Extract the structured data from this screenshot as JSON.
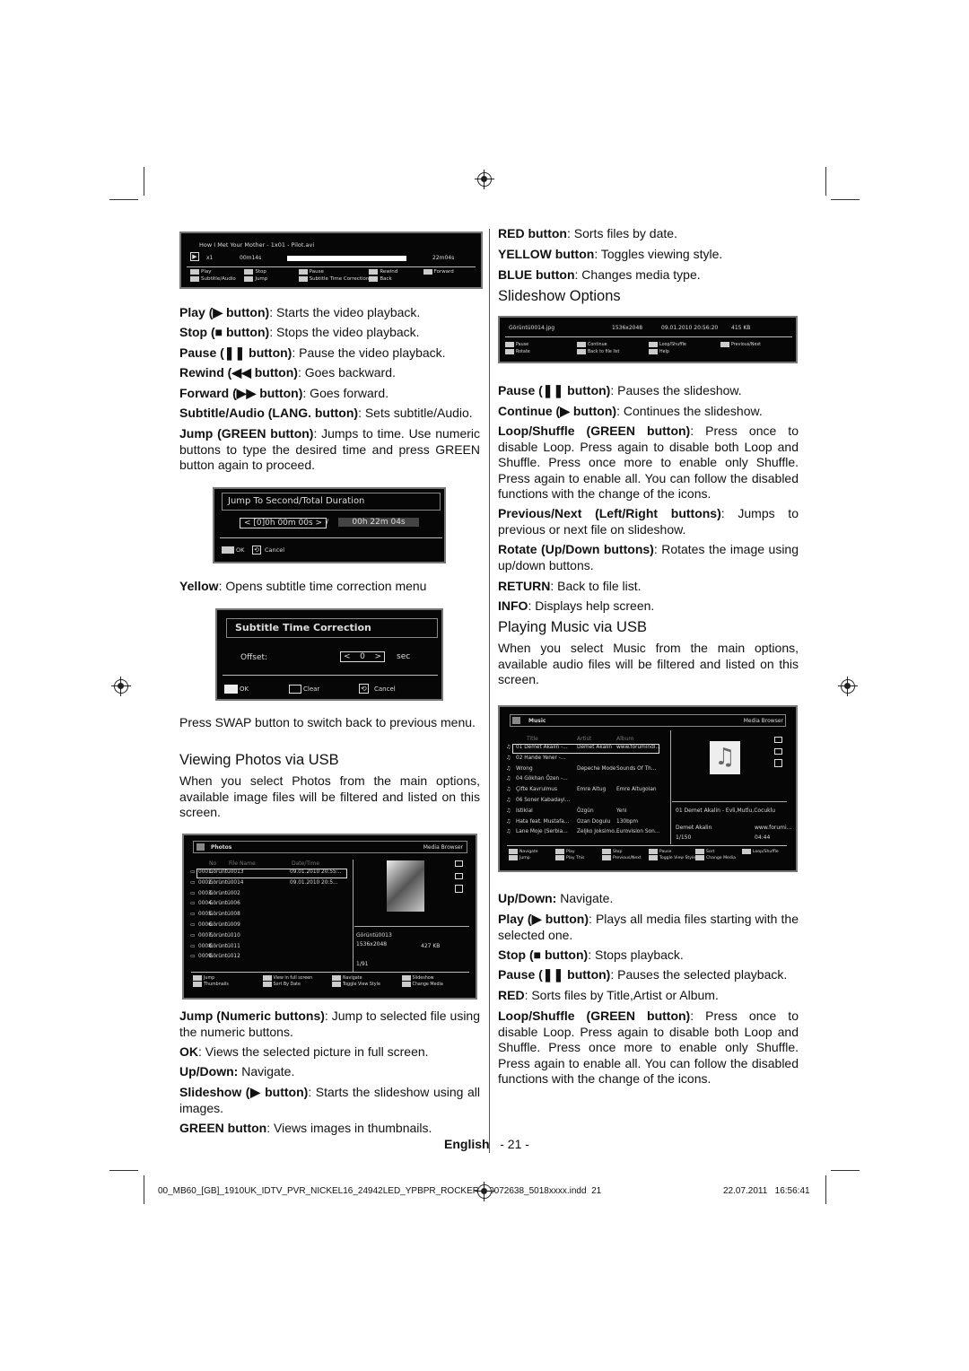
{
  "video_bar": {
    "title": "How I Met Your Mother - 1x01 - Pilot.avi",
    "speed": "x1",
    "elapsed": "00m14s",
    "total": "22m04s",
    "legend": [
      "Play",
      "Stop",
      "Pause",
      "Rewind",
      "Forward",
      "Subtitle/Audio",
      "Jump",
      "Subtitle Time Correction",
      "Back"
    ]
  },
  "left": [
    {
      "b": "Play (▶ button)",
      "t": ": Starts the video playback."
    },
    {
      "b": "Stop (■ button)",
      "t": ": Stops the video playback."
    },
    {
      "b": "Pause (❚❚ button)",
      "t": ": Pause the video playback."
    },
    {
      "b": "Rewind (◀◀ button)",
      "t": ": Goes backward."
    },
    {
      "b": "Forward (▶▶ button)",
      "t": ": Goes forward."
    },
    {
      "b": "Subtitle/Audio (LANG. button)",
      "t": ": Sets subtitle/Audio."
    },
    {
      "b": "Jump (GREEN button)",
      "t": ": Jumps to time. Use numeric buttons to type the desired time and press GREEN button again to proceed."
    },
    {
      "b": "Yellow",
      "t": ": Opens subtitle time correction menu"
    },
    {
      "b": "",
      "t": "Press SWAP button to switch back to previous menu."
    },
    {
      "b": "",
      "t": "When you select Photos from the main options, available image files will be filtered and listed on this screen."
    },
    {
      "b": "Jump (Numeric buttons)",
      "t": ": Jump to selected file using the numeric buttons."
    },
    {
      "b": "OK",
      "t": ": Views the selected picture in full screen."
    },
    {
      "b": "Up/Down:",
      "t": " Navigate."
    },
    {
      "b": "Slideshow (▶ button)",
      "t": ": Starts the slideshow using all images."
    },
    {
      "b": "GREEN button",
      "t": ": Views images in thumbnails."
    }
  ],
  "jump_dialog": {
    "title": "Jump To Second/Total Duration",
    "value": "< [0]0h 00m 00s >",
    "separator": "/",
    "total": "00h 22m 04s",
    "ok": "OK",
    "cancel": "Cancel"
  },
  "subtitle_dialog": {
    "title": "Subtitle Time Correction",
    "offset_label": "Offset:",
    "offset_value": "0",
    "unit": "sec",
    "ok": "OK",
    "clear": "Clear",
    "cancel": "Cancel"
  },
  "headings": {
    "photos": "Viewing Photos via USB",
    "slideshow": "Slideshow Options",
    "music": "Playing Music via USB"
  },
  "photos_screen": {
    "title": "Photos",
    "browser": "Media Browser",
    "cols": [
      "No",
      "File Name",
      "Date/Time"
    ],
    "rows": [
      [
        "0001.",
        "Görüntü0013",
        "09.01.2010 20:55:.."
      ],
      [
        "0002.",
        "Görüntü0014",
        "09.01.2010 20:5..."
      ],
      [
        "0003.",
        "Görüntü002",
        ""
      ],
      [
        "0004.",
        "Görüntü006",
        ""
      ],
      [
        "0005.",
        "Görüntü008",
        ""
      ],
      [
        "0006.",
        "Görüntü009",
        ""
      ],
      [
        "0007.",
        "Görüntü010",
        ""
      ],
      [
        "0008.",
        "Görüntü011",
        ""
      ],
      [
        "0009.",
        "Görüntü012",
        ""
      ]
    ],
    "info_name": "Görüntü0013",
    "info_res": "1536x2048",
    "info_size": "427 KB",
    "info_count": "1/91",
    "legend": [
      "Jump",
      "View in full screen",
      "Navigate",
      "Slideshow",
      "Thumbnails",
      "Sort By Date",
      "Toggle View Style",
      "Change Media"
    ]
  },
  "right": [
    {
      "b": "RED button",
      "t": ": Sorts files by date."
    },
    {
      "b": "YELLOW button",
      "t": ": Toggles viewing style."
    },
    {
      "b": "BLUE button",
      "t": ": Changes media type."
    },
    {
      "b": "Pause (❚❚ button)",
      "t": ": Pauses the slideshow."
    },
    {
      "b": "Continue (▶ button)",
      "t": ": Continues the slideshow."
    },
    {
      "b": "Loop/Shuffle (GREEN button)",
      "t": ": Press once to disable Loop. Press again to disable both Loop and Shuffle. Press once more to enable only Shuffle. Press again to enable all. You can follow the disabled functions with the change of the icons."
    },
    {
      "b": "Previous/Next (Left/Right buttons)",
      "t": ": Jumps to previous or next file on slideshow."
    },
    {
      "b": "Rotate (Up/Down buttons)",
      "t": ": Rotates the image using up/down buttons."
    },
    {
      "b": "RETURN",
      "t": ": Back to file list."
    },
    {
      "b": "INFO",
      "t": ": Displays help screen."
    },
    {
      "b": "",
      "t": "When you select Music from the main options, available audio files will be filtered and listed on this screen."
    },
    {
      "b": "Up/Down:",
      "t": " Navigate."
    },
    {
      "b": "Play (▶ button)",
      "t": ": Plays all media files starting with the selected one."
    },
    {
      "b": "Stop (■ button)",
      "t": ": Stops playback."
    },
    {
      "b": "Pause (❚❚ button)",
      "t": ": Pauses the selected playback."
    },
    {
      "b": "RED",
      "t": ": Sorts files by Title,Artist or Album."
    },
    {
      "b": "Loop/Shuffle (GREEN button)",
      "t": ": Press once to disable Loop. Press again to disable both Loop and Shuffle. Press once more to enable only Shuffle. Press again to enable all. You can follow the disabled functions with the change of the icons."
    }
  ],
  "slideshow_bar": {
    "file": "Görüntü0014.jpg",
    "res": "1536x2048",
    "date": "09.01.2010 20:56:20",
    "size": "415 KB",
    "legend": [
      "Pause",
      "Continue",
      "Loop/Shuffle",
      "Previous/Next",
      "Rotate",
      "Back to file list",
      "Help"
    ]
  },
  "music_screen": {
    "title": "Music",
    "browser": "Media Browser",
    "cols": [
      "Title",
      "Artist",
      "Album"
    ],
    "rows": [
      [
        "01 Demet Akalin -...",
        "Demet Akalin",
        "www.forumindi..."
      ],
      [
        "02 Hande Yener -...",
        "",
        ""
      ],
      [
        "Wrong",
        "Depeche Mode",
        "Sounds Of Th..."
      ],
      [
        "04 Gökhan Özen -...",
        "",
        ""
      ],
      [
        "Çifte Kavrulmus",
        "Emre Altug",
        "Emre Altugolan"
      ],
      [
        "06 Soner Kabadayi...",
        "",
        ""
      ],
      [
        "Istiklal",
        "Özgün",
        "Yeni"
      ],
      [
        "Hata feat. Mustafa...",
        "Ozan Dogulu",
        "130bpm"
      ],
      [
        "Lane Moje (Serbia...",
        "Zeljko Joksimo...",
        "Eurovision Son..."
      ]
    ],
    "info_track": "01 Demet Akalin - Evli,Mutlu,Cocuklu",
    "info_artist": "Demet Akalin",
    "info_album": "www.forumi...",
    "info_count": "1/150",
    "info_time": "04:44",
    "legend": [
      "Navigate",
      "Play",
      "Stop",
      "Pause",
      "Sort",
      "Loop/Shuffle",
      "Jump",
      "Play This",
      "Previous/Next",
      "Toggle View Style",
      "Change Media"
    ]
  },
  "footer": {
    "language": "English",
    "page": "- 21 -",
    "file": "00_MB60_[GB]_1910UK_IDTV_PVR_NICKEL16_24942LED_YPBPR_ROCKER_10072638_5018xxxx.indd  21",
    "date": "22.07.2011   16:56:41"
  }
}
